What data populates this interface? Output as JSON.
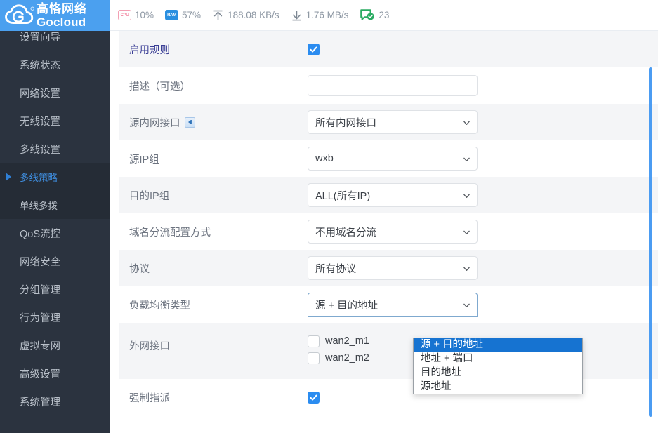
{
  "brand": {
    "name_cn": "高恪网络",
    "name_en": "Gocloud",
    "logo_icon": "cloud-g-logo",
    "bg_color": "#4ba0ef"
  },
  "topbar": {
    "stats": [
      {
        "icon": "cpu-chip-icon",
        "chip_label": "CPU",
        "value": "10%",
        "name": "cpu-usage"
      },
      {
        "icon": "ram-chip-icon",
        "chip_label": "RAM",
        "value": "57%",
        "name": "ram-usage"
      },
      {
        "icon": "upload-arrow-icon",
        "chip_label": "",
        "value": "188.08 KB/s",
        "name": "upload-speed"
      },
      {
        "icon": "download-arrow-icon",
        "chip_label": "",
        "value": "1.76 MB/s",
        "name": "download-speed"
      },
      {
        "icon": "online-devices-icon",
        "chip_label": "",
        "value": "23",
        "name": "online-devices"
      }
    ]
  },
  "sidebar": {
    "items": [
      {
        "label": "设置向导",
        "name": "sidebar-item-setup-wizard",
        "type": "top",
        "active": false
      },
      {
        "label": "系统状态",
        "name": "sidebar-item-system-status",
        "type": "top",
        "active": false
      },
      {
        "label": "网络设置",
        "name": "sidebar-item-network-settings",
        "type": "top",
        "active": false
      },
      {
        "label": "无线设置",
        "name": "sidebar-item-wireless-settings",
        "type": "top",
        "active": false
      },
      {
        "label": "多线设置",
        "name": "sidebar-item-multiwan-settings",
        "type": "top",
        "active": false
      },
      {
        "label": "多线策略",
        "name": "sidebar-item-multiwan-policy",
        "type": "sub",
        "active": true
      },
      {
        "label": "单线多拨",
        "name": "sidebar-item-single-multidial",
        "type": "sub",
        "active": false
      },
      {
        "label": "QoS流控",
        "name": "sidebar-item-qos",
        "type": "top",
        "active": false
      },
      {
        "label": "网络安全",
        "name": "sidebar-item-network-security",
        "type": "top",
        "active": false
      },
      {
        "label": "分组管理",
        "name": "sidebar-item-group-management",
        "type": "top",
        "active": false
      },
      {
        "label": "行为管理",
        "name": "sidebar-item-behavior-management",
        "type": "top",
        "active": false
      },
      {
        "label": "虚拟专网",
        "name": "sidebar-item-vpn",
        "type": "top",
        "active": false
      },
      {
        "label": "高级设置",
        "name": "sidebar-item-advanced-settings",
        "type": "top",
        "active": false
      },
      {
        "label": "系统管理",
        "name": "sidebar-item-system-management",
        "type": "top",
        "active": false
      }
    ],
    "active_color": "#3f8ee0",
    "bg_color": "#2b333f",
    "submenu_bg_color": "#252c36"
  },
  "form": {
    "rows": [
      {
        "label": "启用规则",
        "name": "enable-rule",
        "control": "checkbox",
        "checked": true,
        "label_highlight": true
      },
      {
        "label": "描述（可选）",
        "name": "description",
        "control": "text",
        "value": "",
        "placeholder": ""
      },
      {
        "label": "源内网接口",
        "name": "source-lan-interface",
        "control": "select",
        "value": "所有内网接口",
        "has_help_icon": true
      },
      {
        "label": "源IP组",
        "name": "source-ip-group",
        "control": "select",
        "value": "wxb"
      },
      {
        "label": "目的IP组",
        "name": "destination-ip-group",
        "control": "select",
        "value": "ALL(所有IP)"
      },
      {
        "label": "域名分流配置方式",
        "name": "domain-split-mode",
        "control": "select",
        "value": "不用域名分流"
      },
      {
        "label": "协议",
        "name": "protocol",
        "control": "select",
        "value": "所有协议"
      },
      {
        "label": "负载均衡类型",
        "name": "load-balance-type",
        "control": "select-open",
        "value": "源 + 目的地址"
      },
      {
        "label": "外网接口",
        "name": "wan-interface",
        "control": "checkbox-list"
      },
      {
        "label": "强制指派",
        "name": "force-assign",
        "control": "checkbox",
        "checked": true
      }
    ]
  },
  "load_balance_dropdown": {
    "name": "load-balance-type-options",
    "options": [
      {
        "label": "源 + 目的地址",
        "selected": true
      },
      {
        "label": "地址 + 端口",
        "selected": false
      },
      {
        "label": "目的地址",
        "selected": false
      },
      {
        "label": "源地址",
        "selected": false
      }
    ],
    "highlight_color": "#1673d1"
  },
  "wan_interfaces": [
    {
      "label": "wan2_m1",
      "checked": false,
      "name": "wan-checkbox-wan2-m1"
    },
    {
      "label": "wan2_m2",
      "checked": false,
      "name": "wan-checkbox-wan2-m2"
    }
  ],
  "colors": {
    "accent": "#2b8cf0",
    "header_blue": "#4ba0ef",
    "sidebar_dark": "#2b333f",
    "row_alt": "#f4f5f7",
    "label_text": "#6d7480"
  }
}
